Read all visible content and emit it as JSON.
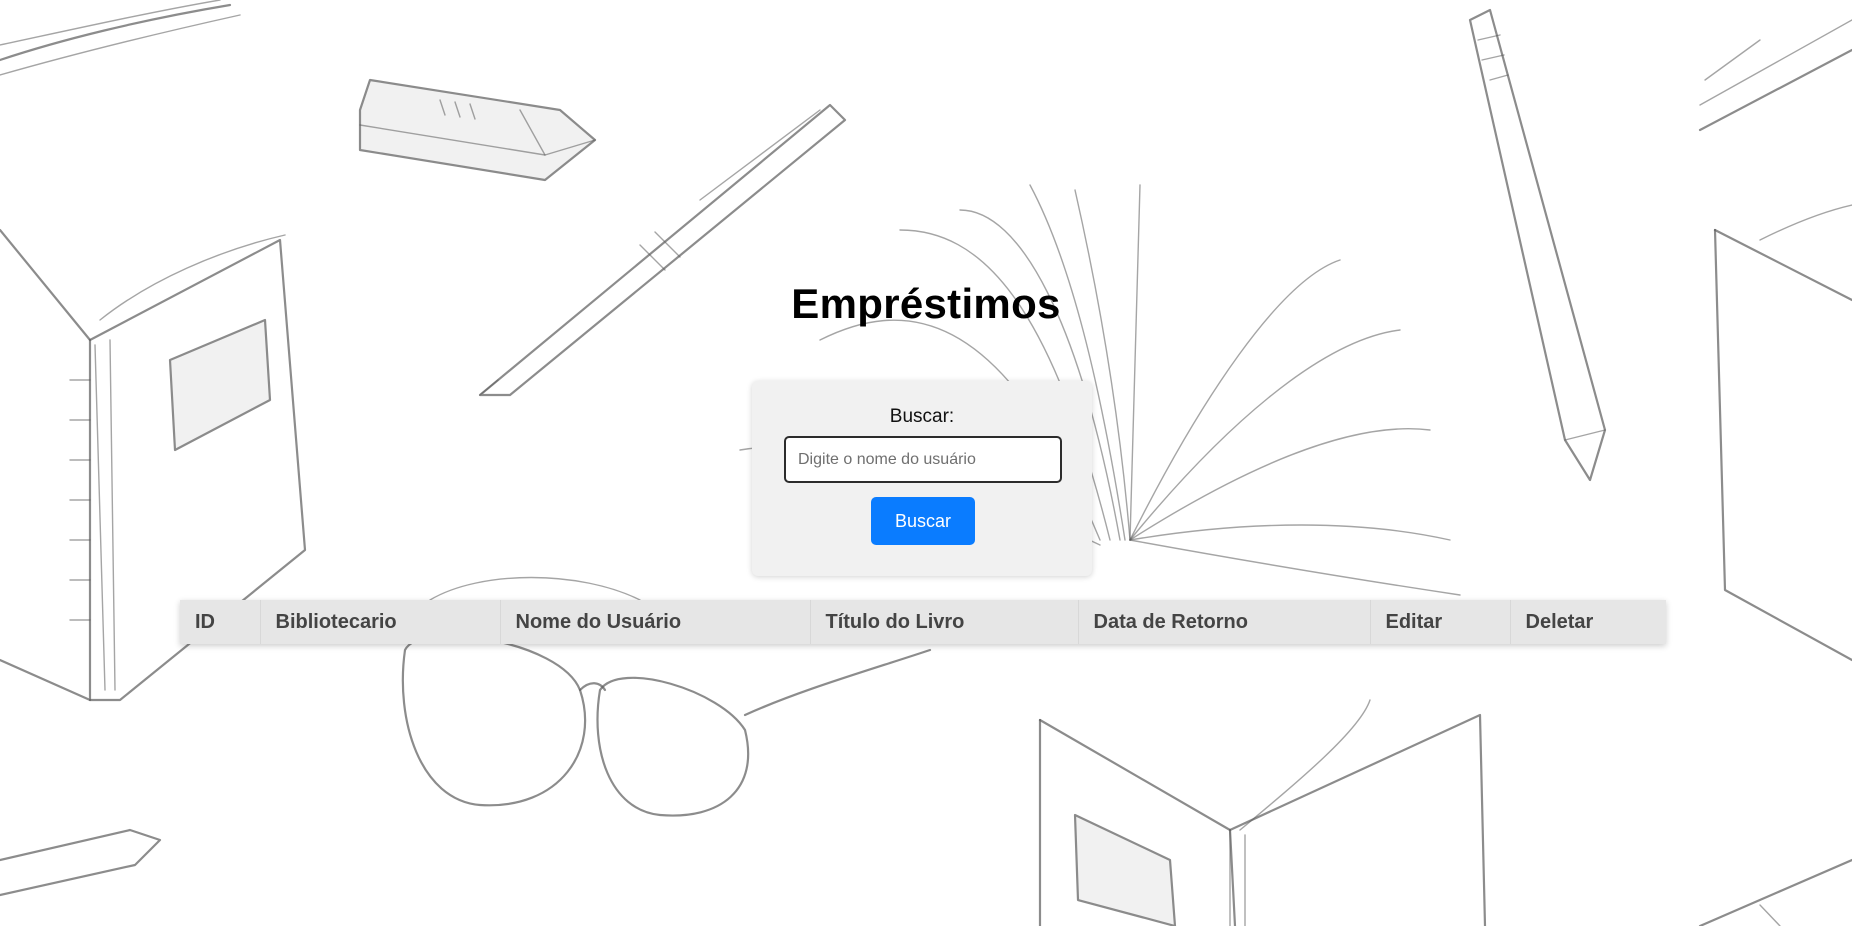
{
  "page": {
    "title": "Empréstimos"
  },
  "search": {
    "label": "Buscar:",
    "placeholder": "Digite o nome do usuário",
    "value": "",
    "button_label": "Buscar"
  },
  "table": {
    "columns": [
      "ID",
      "Bibliotecario",
      "Nome do Usuário",
      "Título do Livro",
      "Data de Retorno",
      "Editar",
      "Deletar"
    ],
    "rows": []
  },
  "colors": {
    "accent": "#0a7cff",
    "panel": "#f1f1f1",
    "table_header": "#e6e6e6"
  },
  "background": {
    "icons": [
      "book-icon",
      "pen-icon",
      "pencil-icon",
      "eraser-icon",
      "glasses-icon"
    ]
  }
}
